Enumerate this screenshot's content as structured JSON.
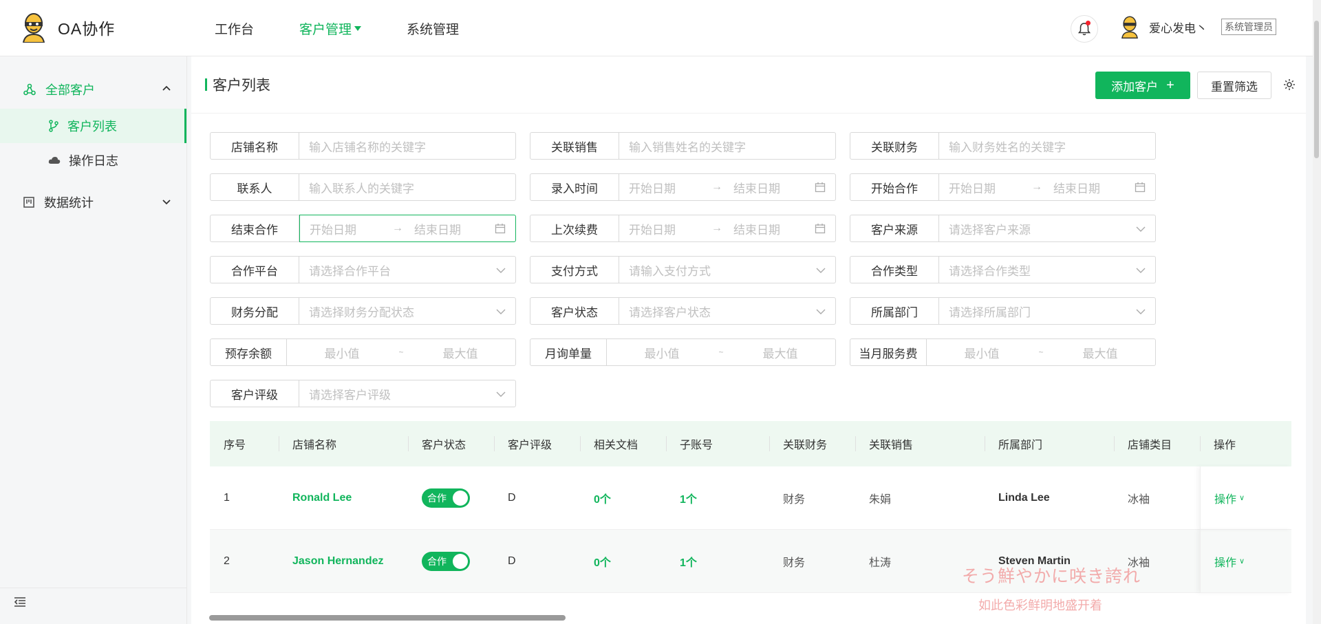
{
  "app": {
    "name": "OA协作"
  },
  "nav": [
    {
      "label": "工作台",
      "active": false
    },
    {
      "label": "客户管理",
      "active": true
    },
    {
      "label": "系统管理",
      "active": false
    }
  ],
  "user": {
    "name": "爱心发电丶",
    "role": "系统管理员"
  },
  "sidebar": {
    "group1": "全部客户",
    "sub1": "客户列表",
    "sub2": "操作日志",
    "group2": "数据统计"
  },
  "page": {
    "title": "客户列表",
    "add_label": "添加客户",
    "reset_label": "重置筛选"
  },
  "filters": {
    "shop_name": {
      "label": "店铺名称",
      "placeholder": "输入店铺名称的关键字"
    },
    "sales": {
      "label": "关联销售",
      "placeholder": "输入销售姓名的关键字"
    },
    "finance": {
      "label": "关联财务",
      "placeholder": "输入财务姓名的关键字"
    },
    "contact": {
      "label": "联系人",
      "placeholder": "输入联系人的关键字"
    },
    "entry_time": {
      "label": "录入时间",
      "start": "开始日期",
      "end": "结束日期"
    },
    "start_coop": {
      "label": "开始合作",
      "start": "开始日期",
      "end": "结束日期"
    },
    "end_coop": {
      "label": "结束合作",
      "start": "开始日期",
      "end": "结束日期"
    },
    "last_renew": {
      "label": "上次续费",
      "start": "开始日期",
      "end": "结束日期"
    },
    "source": {
      "label": "客户来源",
      "placeholder": "请选择客户来源"
    },
    "platform": {
      "label": "合作平台",
      "placeholder": "请选择合作平台"
    },
    "payment": {
      "label": "支付方式",
      "placeholder": "请输入支付方式"
    },
    "coop_type": {
      "label": "合作类型",
      "placeholder": "请选择合作类型"
    },
    "fin_alloc": {
      "label": "财务分配",
      "placeholder": "请选择财务分配状态"
    },
    "cust_status": {
      "label": "客户状态",
      "placeholder": "请选择客户状态"
    },
    "dept": {
      "label": "所属部门",
      "placeholder": "请选择所属部门"
    },
    "prepaid": {
      "label": "预存余额",
      "min": "最小值",
      "max": "最大值"
    },
    "monthly_orders": {
      "label": "月询单量",
      "min": "最小值",
      "max": "最大值"
    },
    "monthly_fee": {
      "label": "当月服务费",
      "min": "最小值",
      "max": "最大值"
    },
    "rating": {
      "label": "客户评级",
      "placeholder": "请选择客户评级"
    }
  },
  "table": {
    "headers": [
      "序号",
      "店铺名称",
      "客户状态",
      "客户评级",
      "相关文档",
      "子账号",
      "关联财务",
      "关联销售",
      "所属部门",
      "店铺类目",
      "操作"
    ],
    "rows": [
      {
        "no": "1",
        "shop": "Ronald Lee",
        "status": "合作",
        "rating": "D",
        "docs": "0个",
        "subs": "1个",
        "finance": "财务",
        "sales": "朱娟",
        "dept": "Linda Lee",
        "category": "冰袖",
        "op": "操作"
      },
      {
        "no": "2",
        "shop": "Jason Hernandez",
        "status": "合作",
        "rating": "D",
        "docs": "0个",
        "subs": "1个",
        "finance": "财务",
        "sales": "杜涛",
        "dept": "Steven Martin",
        "category": "冰袖",
        "op": "操作"
      }
    ]
  },
  "watermark": {
    "line1": "そう鮮やかに咲き誇れ",
    "line2": "如此色彩鲜明地盛开着"
  }
}
